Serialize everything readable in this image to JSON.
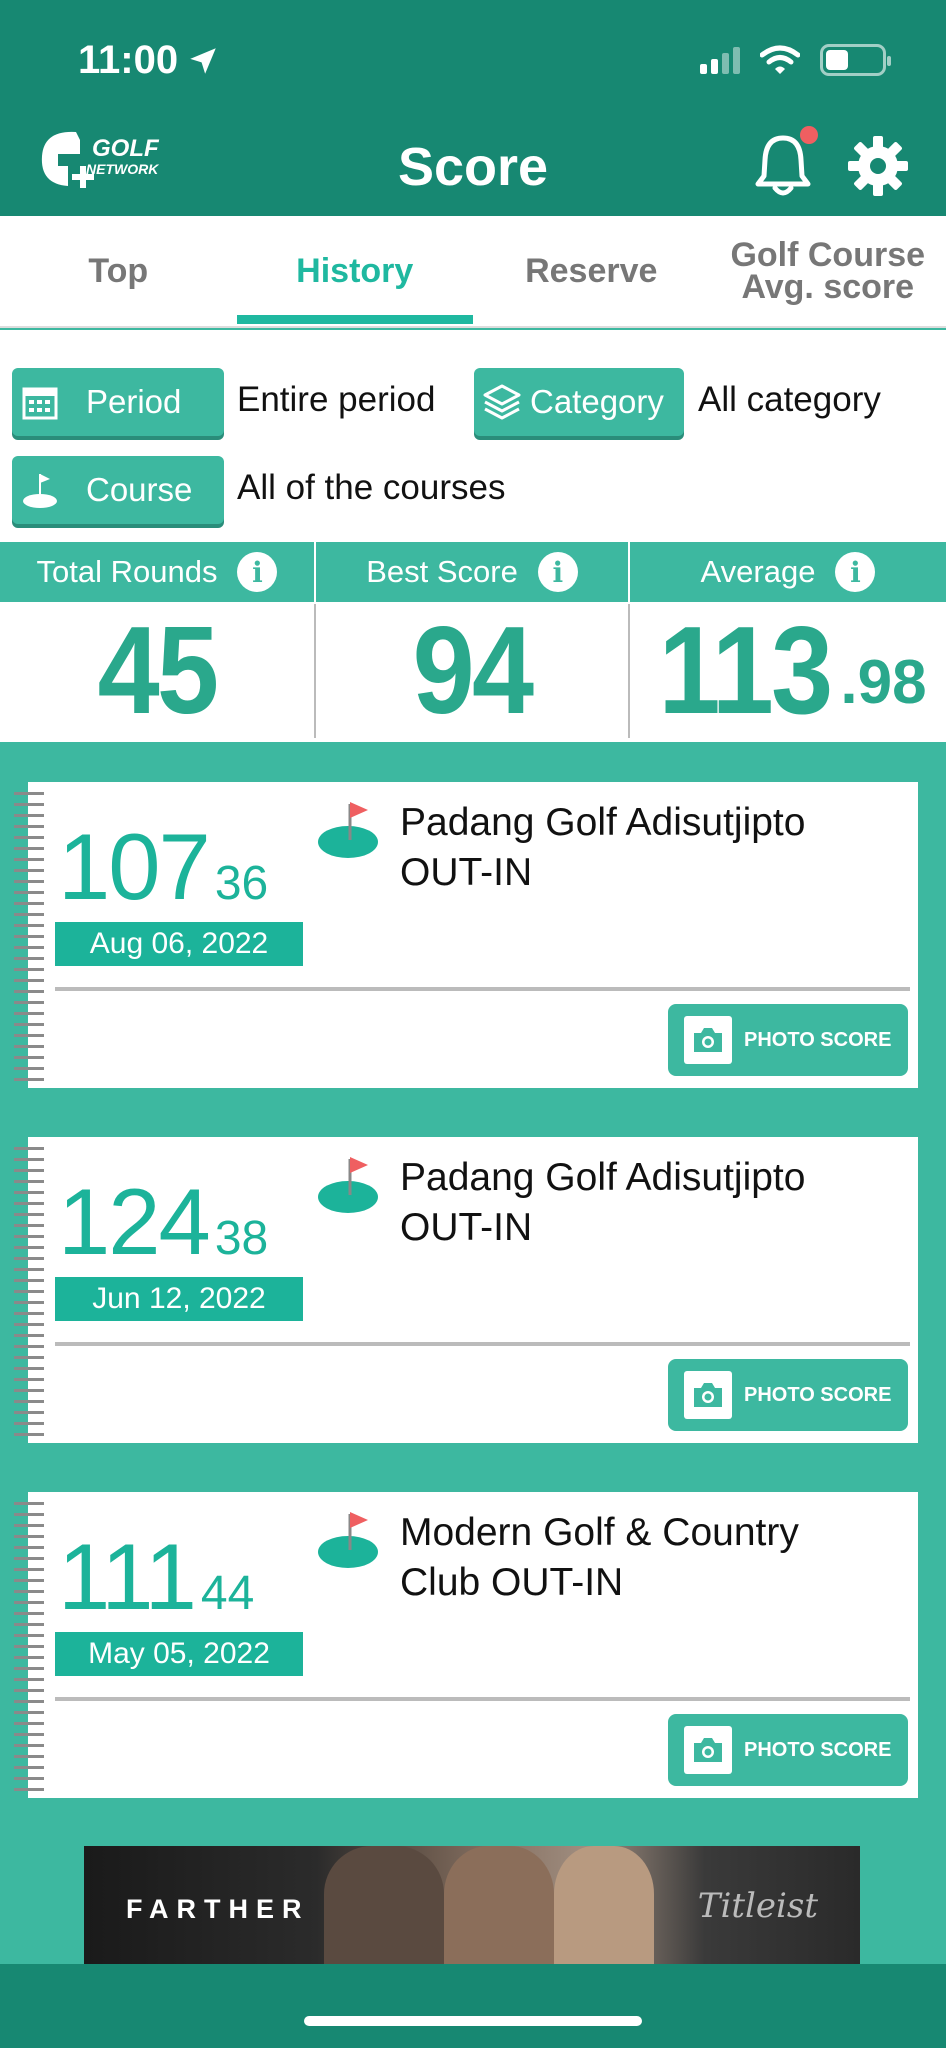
{
  "status_bar": {
    "time": "11:00"
  },
  "header": {
    "title": "Score",
    "logo_text_line1": "GOLF",
    "logo_text_line2": "NETWORK"
  },
  "tabs": [
    {
      "label": "Top"
    },
    {
      "label": "History"
    },
    {
      "label": "Reserve"
    },
    {
      "label_line1": "Golf Course",
      "label_line2": "Avg. score"
    }
  ],
  "active_tab": "History",
  "filters": {
    "period": {
      "label": "Period",
      "value": "Entire period"
    },
    "category": {
      "label": "Category",
      "value": "All category"
    },
    "course": {
      "label": "Course",
      "value": "All of the courses"
    }
  },
  "stats": {
    "total_rounds": {
      "label": "Total Rounds",
      "value": "45"
    },
    "best_score": {
      "label": "Best Score",
      "value": "94"
    },
    "average": {
      "label": "Average",
      "value_int": "113",
      "value_dec": ".98"
    }
  },
  "rounds": [
    {
      "score": "107",
      "putts": "36",
      "date": "Aug 06, 2022",
      "course_line1": "Padang Golf Adisutjipto",
      "course_line2": "OUT-IN",
      "photo_label": "PHOTO SCORE"
    },
    {
      "score": "124",
      "putts": "38",
      "date": "Jun 12, 2022",
      "course_line1": "Padang Golf Adisutjipto",
      "course_line2": "OUT-IN",
      "photo_label": "PHOTO SCORE"
    },
    {
      "score": "111",
      "putts": "44",
      "date": "May 05, 2022",
      "course_line1": "Modern Golf & Country",
      "course_line2": "Club OUT-IN",
      "photo_label": "PHOTO SCORE"
    }
  ],
  "ad": {
    "headline": "FARTHER",
    "brand": "Titleist"
  },
  "colors": {
    "header": "#178872",
    "accent": "#3db8a0",
    "score_green": "#1cb39a",
    "notification": "#ef5f61"
  }
}
